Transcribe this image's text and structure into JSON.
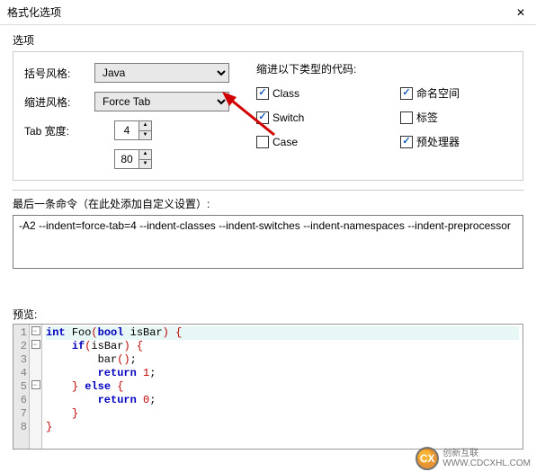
{
  "title": "格式化选项",
  "options_label": "选项",
  "labels": {
    "bracket": "括号风格:",
    "indent": "缩进风格:",
    "tabwidth": "Tab 宽度:",
    "indent_types": "缩进以下类型的代码:",
    "cmdline": "最后一条命令（在此处添加自定义设置）:",
    "preview": "预览:"
  },
  "bracket_value": "Java",
  "indent_value": "Force Tab",
  "tabwidth_value": "4",
  "width_value": "80",
  "checks": {
    "class": "Class",
    "namespace": "命名空间",
    "switch": "Switch",
    "label": "标签",
    "case": "Case",
    "preproc": "预处理器"
  },
  "cmdline_text": "-A2 --indent=force-tab=4 --indent-classes --indent-switches --indent-namespaces --indent-preprocessor",
  "code_lines": [
    {
      "n": "1",
      "fold": "m",
      "hl": true,
      "html": "<span class='kw'>int</span> <span class='fn'>Foo</span><span class='br'>(</span><span class='kw'>bool</span> isBar<span class='br'>)</span> <span class='br'>{</span>"
    },
    {
      "n": "2",
      "fold": "m",
      "html": "    <span class='kw'>if</span><span class='br'>(</span>isBar<span class='br'>)</span> <span class='br'>{</span>"
    },
    {
      "n": "3",
      "fold": "",
      "html": "        bar<span class='br'>()</span>;"
    },
    {
      "n": "4",
      "fold": "",
      "html": "        <span class='kw'>return</span> <span class='num'>1</span>;"
    },
    {
      "n": "5",
      "fold": "m",
      "html": "    <span class='br'>}</span> <span class='kw'>else</span> <span class='br'>{</span>"
    },
    {
      "n": "6",
      "fold": "",
      "html": "        <span class='kw'>return</span> <span class='num'>0</span>;"
    },
    {
      "n": "7",
      "fold": "",
      "html": "    <span class='br'>}</span>"
    },
    {
      "n": "8",
      "fold": "",
      "html": "<span class='br'>}</span>"
    }
  ],
  "watermark": {
    "brand": "创新互联",
    "url": "WWW.CDCXHL.COM"
  }
}
